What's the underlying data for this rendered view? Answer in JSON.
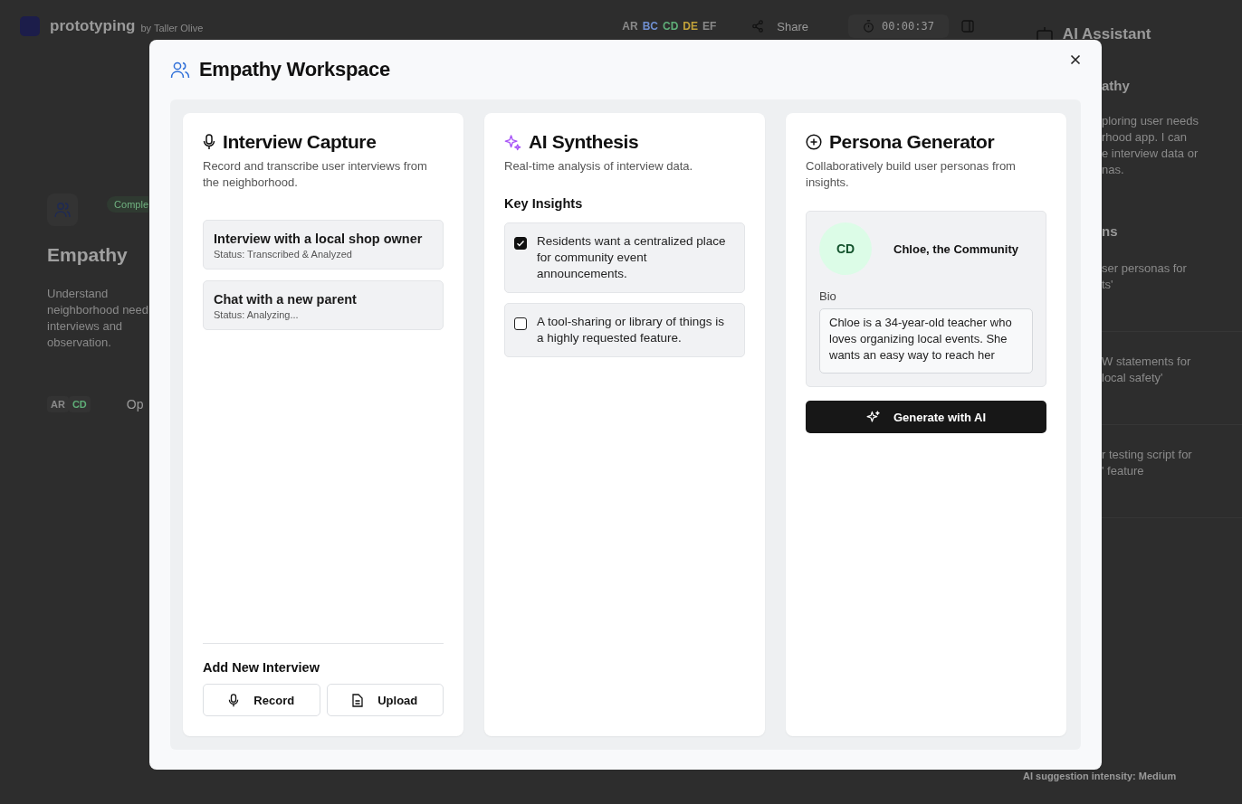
{
  "app": {
    "name": "prototyping",
    "byline": "by Taller Olive",
    "avatars": [
      {
        "initials": "AR",
        "color": "#8a8a8a"
      },
      {
        "initials": "BC",
        "color": "#6f8fd0"
      },
      {
        "initials": "CD",
        "color": "#5fae78"
      },
      {
        "initials": "DE",
        "color": "#c2a23a"
      },
      {
        "initials": "EF",
        "color": "#8a8a8a"
      }
    ],
    "share": "Share",
    "timer": "00:00:37",
    "assistant_title": "AI Assistant"
  },
  "stage_card": {
    "badge": "Comple",
    "title": "Empathy",
    "description_lines": [
      "Understand",
      "neighborhood need",
      "interviews and",
      "observation."
    ],
    "avatars": [
      {
        "initials": "AR",
        "color": "#8a8a8a"
      },
      {
        "initials": "CD",
        "color": "#5fae78"
      }
    ],
    "link": "Op"
  },
  "assistant": {
    "section": "athy",
    "message_lines": [
      "ploring user needs",
      "rhood app. I can",
      "e interview data or",
      "nas."
    ],
    "suggestions_heading": "ns",
    "suggestions": [
      {
        "lines": [
          "ser personas for",
          "ts'"
        ]
      },
      {
        "lines": [
          "W statements for",
          "local safety'"
        ]
      },
      {
        "lines": [
          "r testing script for",
          "' feature"
        ]
      }
    ],
    "intensity": "AI suggestion intensity: Medium"
  },
  "modal": {
    "title": "Empathy Workspace",
    "capture": {
      "title": "Interview Capture",
      "description": "Record and transcribe user interviews from the neighborhood.",
      "interviews": [
        {
          "title": "Interview with a local shop owner",
          "status": "Status: Transcribed & Analyzed"
        },
        {
          "title": "Chat with a new parent",
          "status": "Status: Analyzing..."
        }
      ],
      "add_heading": "Add New Interview",
      "buttons": [
        {
          "kind": "record",
          "label": "Record"
        },
        {
          "kind": "upload",
          "label": "Upload"
        }
      ]
    },
    "synthesis": {
      "title": "AI Synthesis",
      "description": "Real-time analysis of interview data.",
      "insights_heading": "Key Insights",
      "insights": [
        {
          "text": "Residents want a centralized place for community event announcements.",
          "checked": true
        },
        {
          "text": "A tool-sharing or library of things is a highly requested feature.",
          "checked": false
        }
      ]
    },
    "persona": {
      "title": "Persona Generator",
      "description": "Collaboratively build user personas from insights.",
      "initials": "CD",
      "name": "Chloe, the Community",
      "bio_label": "Bio",
      "bio": "Chloe is a 34-year-old teacher who loves organizing local events. She wants an easy way to reach her",
      "button": "Generate with AI"
    }
  }
}
